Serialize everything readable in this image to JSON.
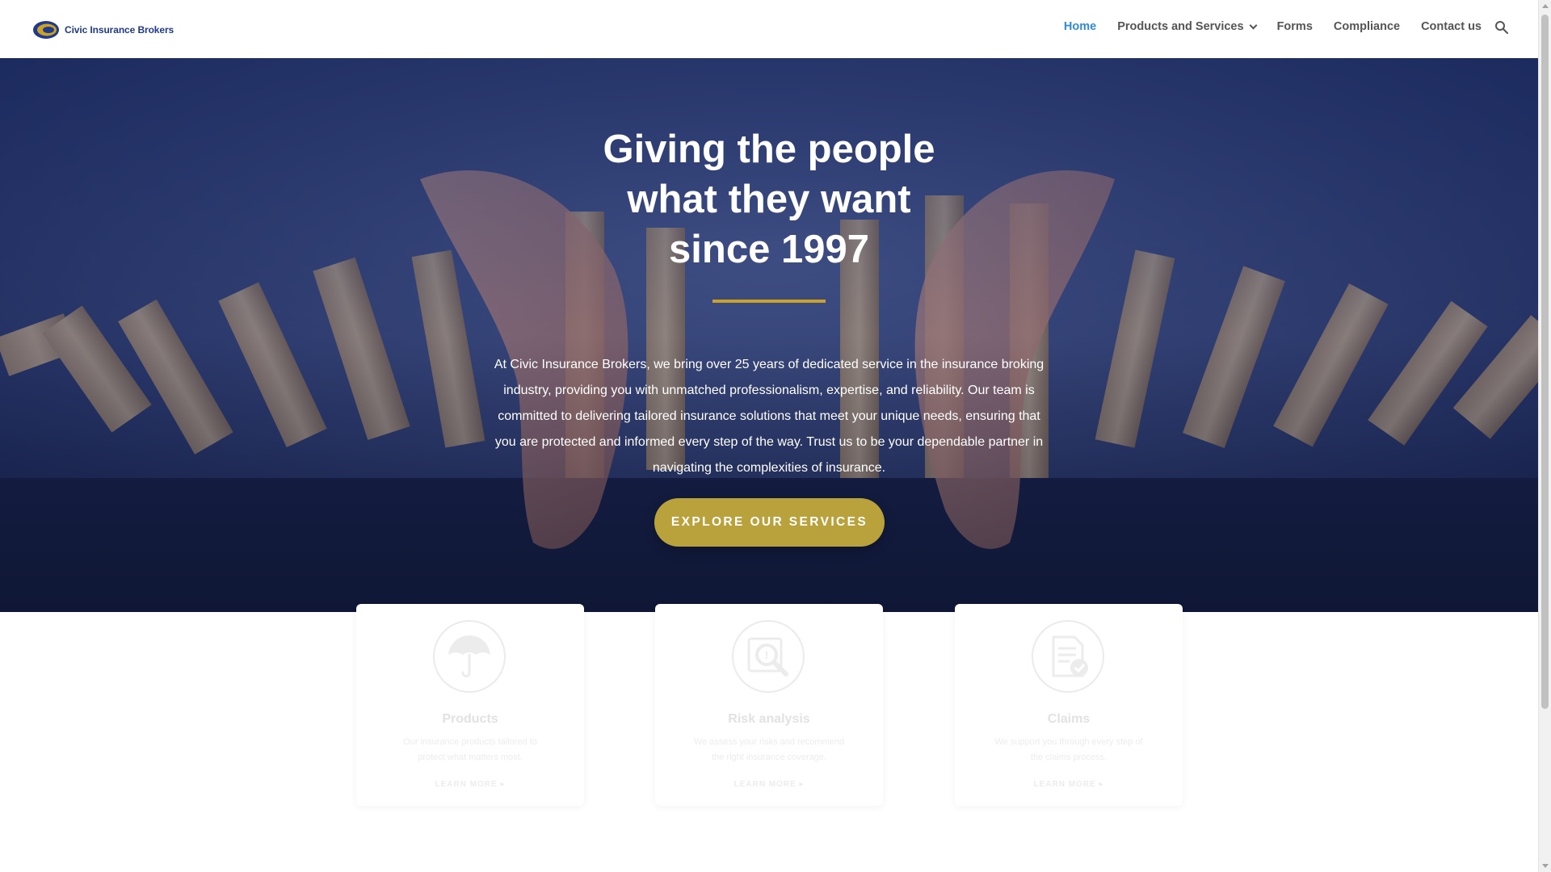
{
  "header": {
    "logo_text": "Civic Insurance Brokers",
    "nav": [
      {
        "label": "Home",
        "active": true
      },
      {
        "label": "Products and Services",
        "has_dropdown": true
      },
      {
        "label": "Forms"
      },
      {
        "label": "Compliance"
      },
      {
        "label": "Contact us"
      }
    ],
    "search_icon": "search-icon"
  },
  "hero": {
    "title_line1": "Giving the people",
    "title_line2": "what they want",
    "title_line3": "since 1997",
    "body": "At Civic Insurance Brokers, we bring over 25 years of dedicated service in the insurance broking industry, providing you with unmatched professionalism, expertise, and reliability. Our team is committed to delivering tailored insurance solutions that meet your unique needs, ensuring that you are protected and informed every step of the way. Trust us to be your dependable partner in navigating the complexities of insurance.",
    "cta_label": "EXPLORE OUR SERVICES"
  },
  "cards": [
    {
      "title": "Products",
      "desc": "Our insurance products tailored to protect what matters most.",
      "link": "LEARN MORE",
      "icon": "umbrella-icon"
    },
    {
      "title": "Risk analysis",
      "desc": "We assess your risks and recommend the right insurance coverage.",
      "link": "LEARN MORE",
      "icon": "magnifier-icon"
    },
    {
      "title": "Claims",
      "desc": "We support you through every step of the claims process.",
      "link": "LEARN MORE",
      "icon": "document-check-icon"
    }
  ],
  "colors": {
    "accent_blue": "#2e8bd8",
    "gold": "#c9a227",
    "cta": "#b9a23c",
    "hero_dark": "#1c2e63"
  }
}
